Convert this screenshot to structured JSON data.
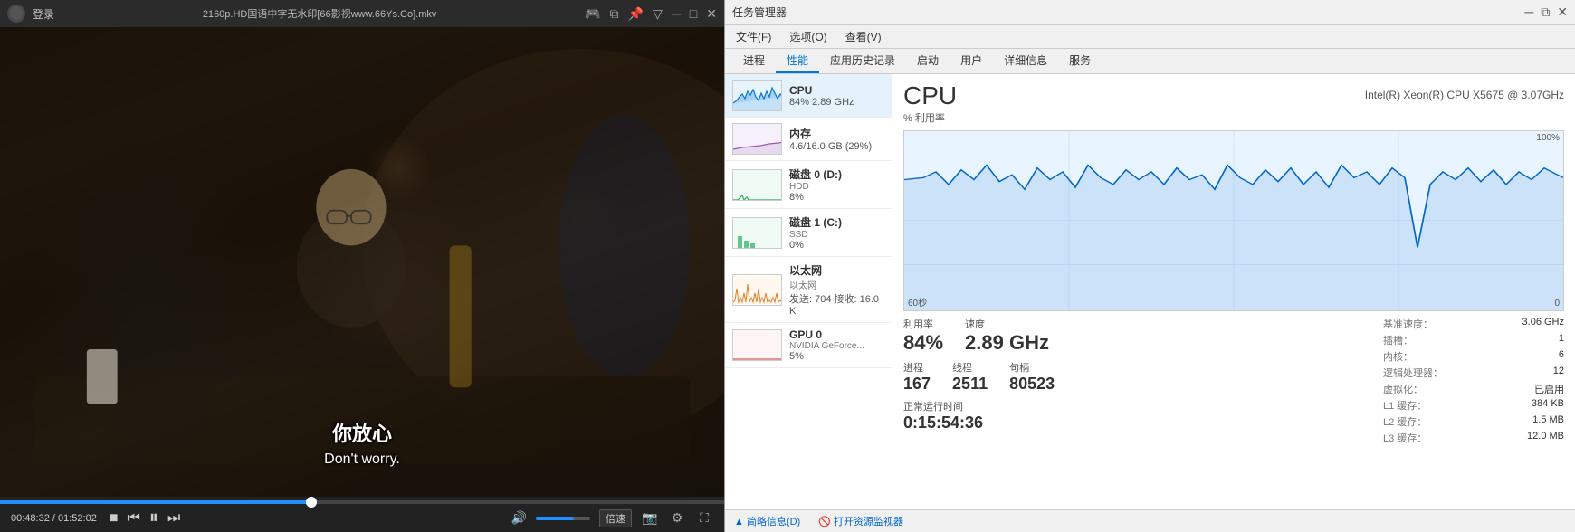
{
  "player": {
    "title": "2160p.HD国语中字无水印[66影视www.66Ys.Co].mkv",
    "login": "登录",
    "subtitle_cn": "你放心",
    "subtitle_en": "Don't worry.",
    "time_current": "00:48:32",
    "time_total": "01:52:02",
    "progress_pct": 43,
    "volume_pct": 70,
    "speed_label": "倍速",
    "controls": {
      "stop": "■",
      "prev": "⏮",
      "play_pause": "⏸",
      "next": "⏭"
    }
  },
  "task_manager": {
    "title": "任务管理器",
    "menus": [
      "文件(F)",
      "选项(O)",
      "查看(V)"
    ],
    "tabs": [
      "进程",
      "性能",
      "应用历史记录",
      "启动",
      "用户",
      "详细信息",
      "服务"
    ],
    "active_tab": "性能",
    "sidebar_items": [
      {
        "id": "cpu",
        "name": "CPU",
        "sub": "84% 2.89 GHz",
        "active": true
      },
      {
        "id": "memory",
        "name": "内存",
        "sub": "4.6/16.0 GB (29%)"
      },
      {
        "id": "disk0",
        "name": "磁盘 0 (D:)",
        "sub2": "HDD",
        "sub": "8%"
      },
      {
        "id": "disk1",
        "name": "磁盘 1 (C:)",
        "sub2": "SSD",
        "sub": "0%"
      },
      {
        "id": "ethernet",
        "name": "以太网",
        "sub2": "以太网",
        "sub": "发送: 704  接收: 16.0 K"
      },
      {
        "id": "gpu",
        "name": "GPU 0",
        "sub2": "NVIDIA GeForce...",
        "sub": "5%"
      }
    ],
    "cpu_detail": {
      "title": "CPU",
      "model": "Intel(R) Xeon(R) CPU X5675 @ 3.07GHz",
      "util_label": "% 利用率",
      "chart_time": "60秒",
      "chart_max": "100%",
      "chart_min": "0",
      "usage_label": "利用率",
      "usage_value": "84%",
      "speed_label": "速度",
      "speed_value": "2.89 GHz",
      "proc_label": "进程",
      "proc_value": "167",
      "thread_label": "线程",
      "thread_value": "2511",
      "handle_label": "句柄",
      "handle_value": "80523",
      "runtime_label": "正常运行时间",
      "runtime_value": "0:15:54:36",
      "specs": {
        "base_speed_label": "基准速度：",
        "base_speed_value": "3.06 GHz",
        "socket_label": "插槽：",
        "socket_value": "1",
        "core_label": "内核：",
        "core_value": "6",
        "logical_label": "逻辑处理器：",
        "logical_value": "12",
        "virtual_label": "虚拟化：",
        "virtual_value": "已启用",
        "l1_label": "L1 缓存：",
        "l1_value": "384 KB",
        "l2_label": "L2 缓存：",
        "l2_value": "1.5 MB",
        "l3_label": "L3 缓存：",
        "l3_value": "12.0 MB"
      }
    },
    "bottom": {
      "summary_link": "▲ 简略信息(D)",
      "resource_link": "🚫 打开资源监视器"
    }
  }
}
